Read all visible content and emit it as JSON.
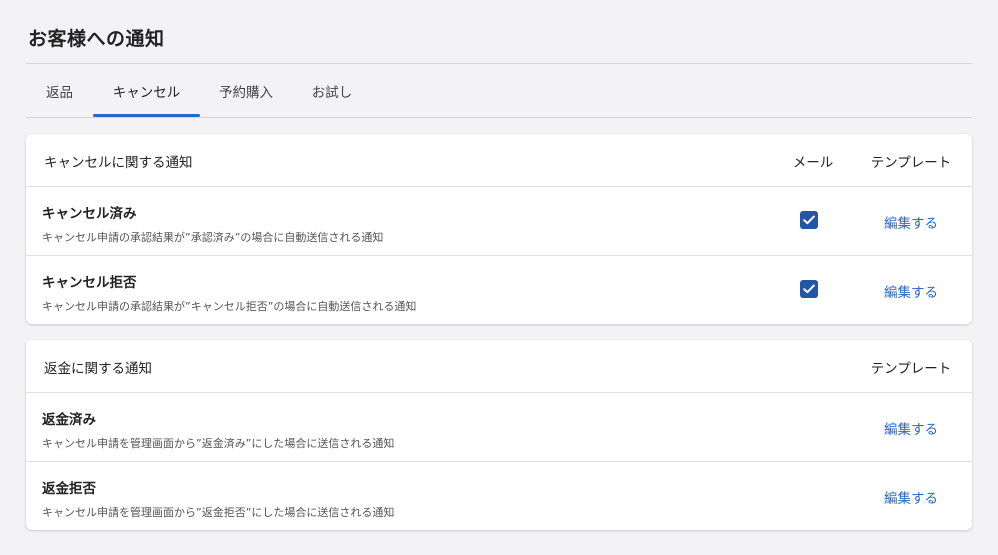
{
  "page": {
    "title": "お客様への通知"
  },
  "tabs": [
    {
      "label": "返品",
      "active": false
    },
    {
      "label": "キャンセル",
      "active": true
    },
    {
      "label": "予約購入",
      "active": false
    },
    {
      "label": "お試し",
      "active": false
    }
  ],
  "cancel_card": {
    "title": "キャンセルに関する通知",
    "col_mail": "メール",
    "col_template": "テンプレート",
    "rows": [
      {
        "title": "キャンセル済み",
        "description": "キャンセル申請の承認結果が”承認済み”の場合に自動送信される通知",
        "mail_checked": true,
        "edit_label": "編集する"
      },
      {
        "title": "キャンセル拒否",
        "description": "キャンセル申請の承認結果が”キャンセル拒否”の場合に自動送信される通知",
        "mail_checked": true,
        "edit_label": "編集する"
      }
    ]
  },
  "refund_card": {
    "title": "返金に関する通知",
    "col_template": "テンプレート",
    "rows": [
      {
        "title": "返金済み",
        "description": "キャンセル申請を管理画面から”返金済み”にした場合に送信される通知",
        "edit_label": "編集する"
      },
      {
        "title": "返金拒否",
        "description": "キャンセル申請を管理画面から”返金拒否”にした場合に送信される通知",
        "edit_label": "編集する"
      }
    ]
  },
  "colors": {
    "accent": "#2b67c8",
    "checkbox": "#2355a8"
  },
  "icons": {
    "checkbox_checked": "check-icon"
  }
}
